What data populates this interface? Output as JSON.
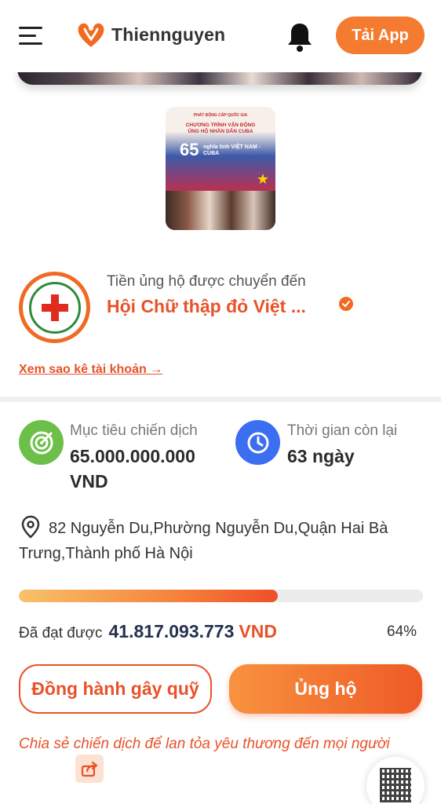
{
  "header": {
    "brand": "Thiennguyen",
    "app_button": "Tải App"
  },
  "poster": {
    "top_line": "PHÁT ĐỘNG CẤP QUỐC GIA",
    "title_line1": "CHƯƠNG TRÌNH VẬN ĐỘNG",
    "title_line2": "ỦNG HỘ NHÂN DÂN CUBA",
    "number": "65",
    "subtitle": "nghĩa tình VIỆT NAM - CUBA"
  },
  "recipient": {
    "label": "Tiền ủng hộ được chuyển đến",
    "name": "Hội Chữ thập đỏ Việt ...",
    "statement_link": "Xem sao kê tài khoản →"
  },
  "stats": {
    "goal_label": "Mục tiêu chiến dịch",
    "goal_value": "65.000.000.000",
    "goal_unit": "VND",
    "time_label": "Thời gian còn lại",
    "time_value": "63 ngày"
  },
  "address": "82 Nguyễn Du,Phường Nguyễn Du,Quận Hai Bà Trưng,Thành phố Hà Nội",
  "progress": {
    "fraction": 0.64,
    "raised_label": "Đã đạt được",
    "raised_amount": "41.817.093.773",
    "raised_unit": "VND",
    "percent": "64%"
  },
  "actions": {
    "fundraise": "Đồng hành gây quỹ",
    "donate": "Ủng hộ"
  },
  "share_text": "Chia sẻ chiến dịch để lan tỏa yêu thương đến mọi người",
  "colors": {
    "accent": "#e8522a",
    "brand_orange": "#f47b2f",
    "goal_green": "#6cc04a",
    "time_blue": "#3b6ef0"
  }
}
